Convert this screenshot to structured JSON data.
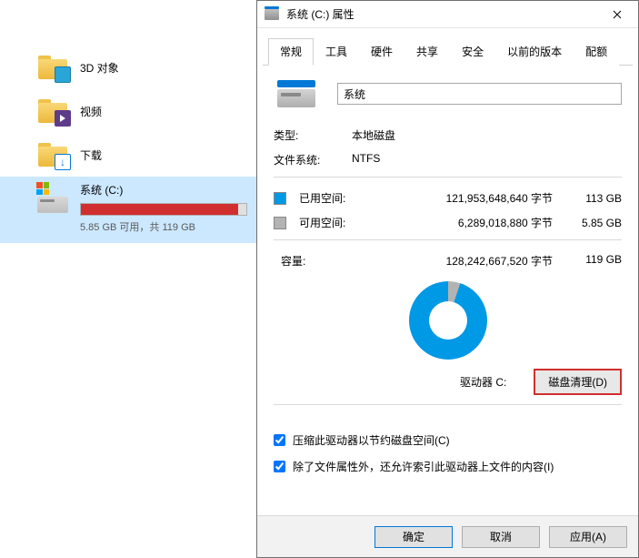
{
  "explorer": {
    "items": [
      {
        "label": "3D 对象",
        "icon": "3d"
      },
      {
        "label": "视频",
        "icon": "video"
      },
      {
        "label": "下载",
        "icon": "download"
      }
    ],
    "drive": {
      "name": "系统 (C:)",
      "subtext": "5.85 GB 可用，共 119 GB",
      "fill_percent": 95
    }
  },
  "dialog": {
    "title": "系统 (C:) 属性",
    "tabs": [
      "常规",
      "工具",
      "硬件",
      "共享",
      "安全",
      "以前的版本",
      "配额"
    ],
    "active_tab": 0,
    "name_value": "系统",
    "type_label": "类型:",
    "type_value": "本地磁盘",
    "fs_label": "文件系统:",
    "fs_value": "NTFS",
    "used_label": "已用空间:",
    "used_bytes": "121,953,648,640 字节",
    "used_gb": "113 GB",
    "free_label": "可用空间:",
    "free_bytes": "6,289,018,880 字节",
    "free_gb": "5.85 GB",
    "capacity_label": "容量:",
    "capacity_bytes": "128,242,667,520 字节",
    "capacity_gb": "119 GB",
    "drive_label": "驱动器 C:",
    "cleanup_button": "磁盘清理(D)",
    "check_compress": "压缩此驱动器以节约磁盘空间(C)",
    "check_index": "除了文件属性外，还允许索引此驱动器上文件的内容(I)",
    "buttons": {
      "ok": "确定",
      "cancel": "取消",
      "apply": "应用(A)"
    }
  }
}
